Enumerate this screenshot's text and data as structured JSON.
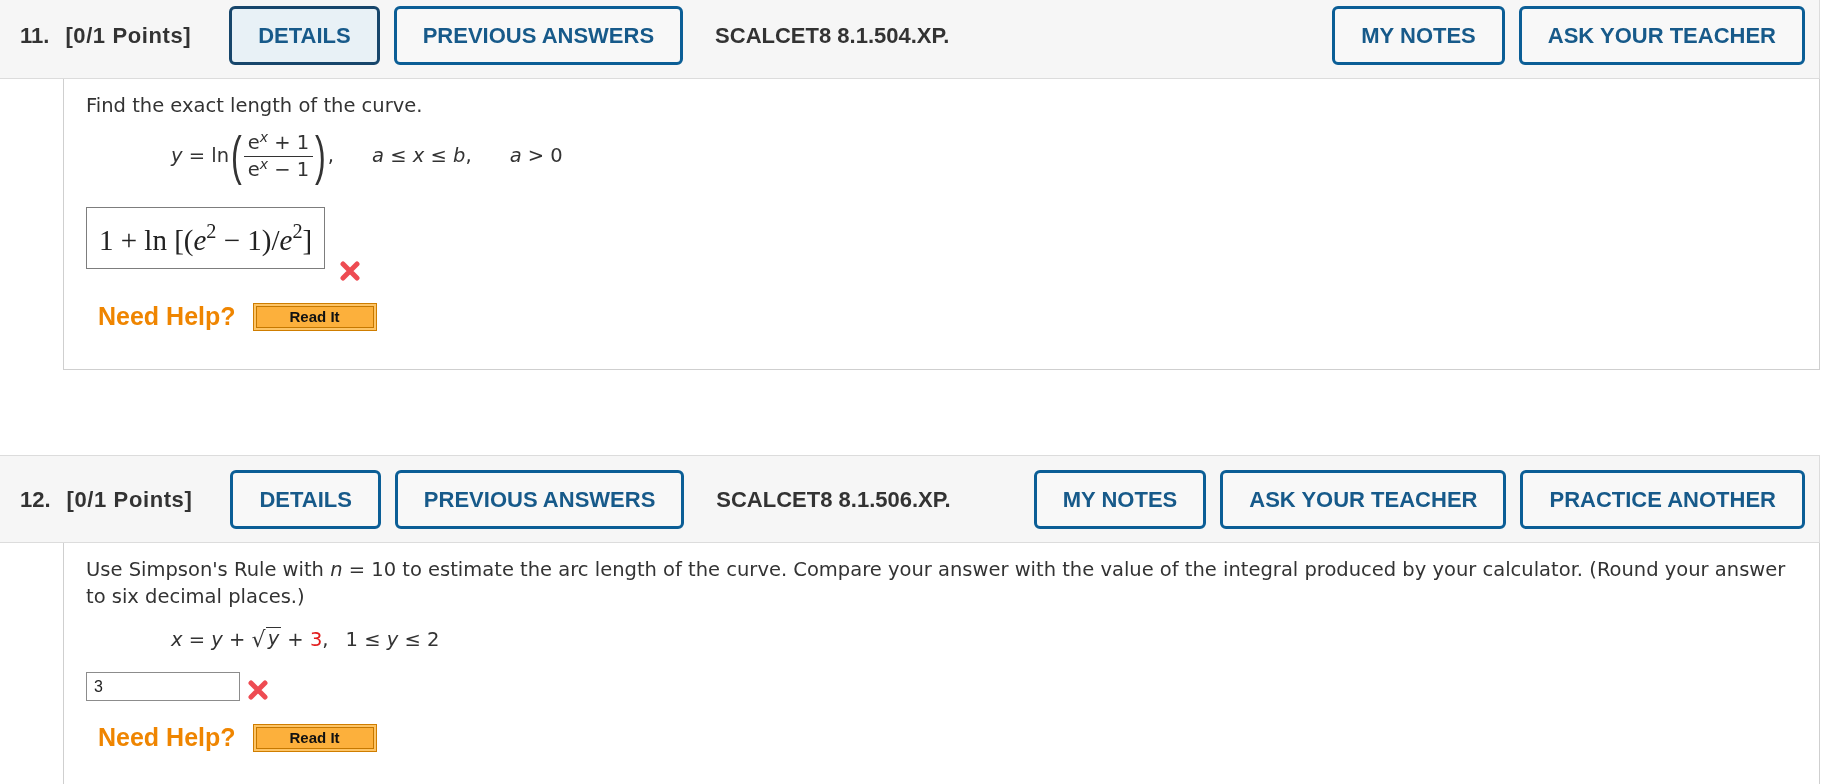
{
  "problems": [
    {
      "number": "11.",
      "points": "[0/1 Points]",
      "left_buttons": [
        {
          "label": "DETAILS",
          "selected": true
        },
        {
          "label": "PREVIOUS ANSWERS",
          "selected": false
        }
      ],
      "code": "SCALCET8 8.1.504.XP.",
      "right_buttons": [
        {
          "label": "MY NOTES",
          "selected": false
        },
        {
          "label": "ASK YOUR TEACHER",
          "selected": false
        }
      ],
      "prompt": "Find the exact length of the curve.",
      "equation": [
        {
          "kind": "plain",
          "text": "*y* = ln"
        },
        {
          "kind": "fraction",
          "open": "(",
          "numerator": "e$^{x}$ + 1",
          "denominator": "e$^{x}$ − 1",
          "close": ")"
        },
        {
          "kind": "plain",
          "text": ","
        }
      ],
      "conditions": [
        "*a* ≤ *x* ≤ *b*,",
        "*a* > 0"
      ],
      "answer": {
        "kind": "math",
        "value": "1 + ln [(*e*$^{2}$ − 1)/*e*$^{2}$]",
        "correct": false
      },
      "help": {
        "label": "Need Help?",
        "buttons": [
          {
            "label": "Read It"
          }
        ]
      }
    },
    {
      "number": "12.",
      "points": "[0/1 Points]",
      "left_buttons": [
        {
          "label": "DETAILS",
          "selected": false
        },
        {
          "label": "PREVIOUS ANSWERS",
          "selected": false
        }
      ],
      "code": "SCALCET8 8.1.506.XP.",
      "right_buttons": [
        {
          "label": "MY NOTES",
          "selected": false
        },
        {
          "label": "ASK YOUR TEACHER",
          "selected": false
        },
        {
          "label": "PRACTICE ANOTHER",
          "selected": false
        }
      ],
      "prompt": "Use Simpson's Rule with *n* = 10 to estimate the arc length of the curve. Compare your answer with the value of the integral produced by your calculator. (Round your answer to six decimal places.)",
      "equation": [
        {
          "kind": "plain",
          "text": "*x* = *y* + "
        },
        {
          "kind": "radical",
          "sign": "√",
          "text": "*y*"
        },
        {
          "kind": "plain",
          "text": " + "
        },
        {
          "kind": "highlight",
          "text": "3"
        },
        {
          "kind": "plain",
          "text": ","
        }
      ],
      "conditions": [
        "1 ≤ *y* ≤ 2"
      ],
      "answer": {
        "kind": "input",
        "value": "3",
        "correct": false
      },
      "help": {
        "label": "Need Help?",
        "buttons": [
          {
            "label": "Read It"
          }
        ]
      }
    }
  ]
}
